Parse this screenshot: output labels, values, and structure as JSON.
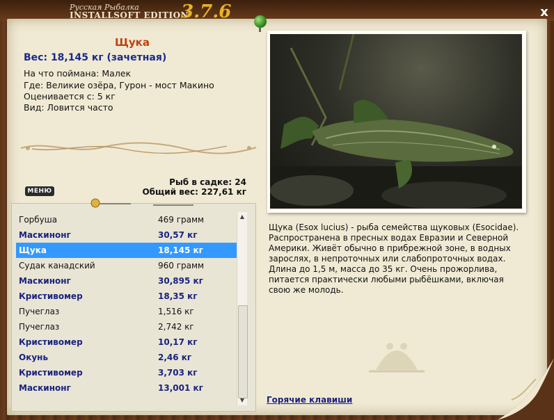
{
  "app": {
    "title_small": "Русская Рыбалка",
    "title_edition": "INSTALLSOFT EDITION",
    "version": "3.7.6",
    "close_label": "x"
  },
  "fish": {
    "name": "Щука",
    "weight_line": "Вес: 18,145 кг (зачетная)",
    "caught_on": "На что поймана: Малек",
    "location": "Где: Великие озёра, Гурон - мост Макино",
    "rated_from": "Оценивается с: 5 кг",
    "type": "Вид: Ловится часто"
  },
  "stats": {
    "in_keepnet": "Рыб в садке: 24",
    "total_weight": "Общий вес: 227,61 кг"
  },
  "menu_label": "МЕНЮ",
  "catch_list": [
    {
      "name": "Горбуша",
      "weight": "469 грамм",
      "trophy": false,
      "selected": false
    },
    {
      "name": "Маскинонг",
      "weight": "30,57 кг",
      "trophy": true,
      "selected": false
    },
    {
      "name": "Щука",
      "weight": "18,145 кг",
      "trophy": true,
      "selected": true
    },
    {
      "name": "Судак канадский",
      "weight": "960 грамм",
      "trophy": false,
      "selected": false
    },
    {
      "name": "Маскинонг",
      "weight": "30,895 кг",
      "trophy": true,
      "selected": false
    },
    {
      "name": "Кристивомер",
      "weight": "18,35 кг",
      "trophy": true,
      "selected": false
    },
    {
      "name": "Пучеглаз",
      "weight": "1,516 кг",
      "trophy": false,
      "selected": false
    },
    {
      "name": "Пучеглаз",
      "weight": "2,742 кг",
      "trophy": false,
      "selected": false
    },
    {
      "name": "Кристивомер",
      "weight": "10,17 кг",
      "trophy": true,
      "selected": false
    },
    {
      "name": "Окунь",
      "weight": "2,46 кг",
      "trophy": true,
      "selected": false
    },
    {
      "name": "Кристивомер",
      "weight": "3,703 кг",
      "trophy": true,
      "selected": false
    },
    {
      "name": "Маскинонг",
      "weight": "13,001 кг",
      "trophy": true,
      "selected": false
    }
  ],
  "description": "Щука (Esox lucius) - рыба семейства щуковых (Esocidae). Распространена в пресных водах Евразии и Северной Америки. Живёт обычно в прибрежной зоне, в водных зарослях, в непроточных или слабопроточных водах. Длина до 1,5 м, масса до 35 кг. Очень прожорлива, питается практически любыми рыбёшками, включая свою же молодь.",
  "hotkeys_link": "Горячие клавиши",
  "colors": {
    "accent_name": "#c0410c",
    "trophy_text": "#1a2280",
    "selection": "#3399ff",
    "paper": "#f0ead4",
    "version_gold": "#e8b22c"
  },
  "icons": {
    "close": "close-icon",
    "pin": "pushpin-icon",
    "scroll_up": "scroll-up-arrow-icon",
    "scroll_down": "scroll-down-arrow-icon"
  }
}
